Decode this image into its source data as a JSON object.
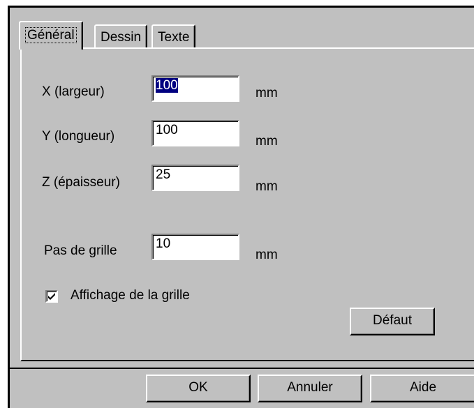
{
  "tabs": [
    {
      "label": "Général",
      "active": true
    },
    {
      "label": "Dessin",
      "active": false
    },
    {
      "label": "Texte",
      "active": false
    }
  ],
  "fields": {
    "x": {
      "label": "X (largeur)",
      "value": "100",
      "unit": "mm",
      "selected": true
    },
    "y": {
      "label": "Y (longueur)",
      "value": "100",
      "unit": "mm"
    },
    "z": {
      "label": "Z (épaisseur)",
      "value": "25",
      "unit": "mm"
    },
    "grid_step": {
      "label": "Pas de grille",
      "value": "10",
      "unit": "mm"
    }
  },
  "show_grid": {
    "label": "Affichage de la grille",
    "checked": true
  },
  "buttons": {
    "default": "Défaut",
    "ok": "OK",
    "cancel": "Annuler",
    "help": "Aide"
  }
}
